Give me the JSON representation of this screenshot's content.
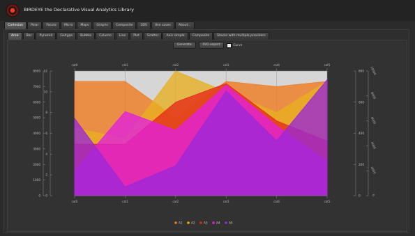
{
  "app": {
    "title": "BIRDEYE the Declarative Visual Analytics Library"
  },
  "main_tabs": [
    "Cartesian",
    "Polar",
    "Facets",
    "Micro",
    "Maps",
    "Graphs",
    "Composite",
    "3DS",
    "Use cases",
    "About..."
  ],
  "main_active": 0,
  "sub_tabs": [
    "Area",
    "Bar",
    "Pyramid",
    "Gohype",
    "Bubble",
    "Column",
    "Line",
    "Plot",
    "Scatter",
    "Axis simple",
    "Composite",
    "Stacks with multiple providers"
  ],
  "sub_active": 0,
  "toolbar": {
    "btn1": "Generate",
    "btn2": "SVG export",
    "curve_label": "Curve"
  },
  "colors": {
    "A1": "#f07a1e",
    "A2": "#e8b020",
    "A3": "#e62a1a",
    "A4": "#e020e0",
    "A5": "#9a28d8"
  },
  "chart_data": {
    "type": "area",
    "categories": [
      "cat0",
      "cat1",
      "cat2",
      "cat3",
      "cat4",
      "cat5"
    ],
    "left_axis_outer": {
      "ticks": [
        0,
        1000,
        2000,
        3000,
        4000,
        5000,
        6000,
        7000,
        8000
      ]
    },
    "left_axis_inner": {
      "ticks": [
        0,
        2,
        4,
        6,
        8,
        10,
        12
      ]
    },
    "right_axis_inner": {
      "ticks": [
        0,
        200,
        400,
        600,
        800
      ]
    },
    "right_axis_outer": {
      "ticks": [
        2000,
        4000,
        6000,
        8000,
        10000
      ]
    },
    "legend": [
      "A1",
      "A2",
      "A3",
      "A4",
      "A5"
    ],
    "series": [
      {
        "name": "A1",
        "axis": "left_inner",
        "values": [
          11,
          11,
          7.5,
          11,
          10.5,
          11
        ]
      },
      {
        "name": "A2",
        "axis": "left_inner",
        "values": [
          6.5,
          5.5,
          12,
          10,
          8,
          11
        ]
      },
      {
        "name": "A3",
        "axis": "right_inner",
        "values": [
          330,
          330,
          600,
          720,
          480,
          350
        ]
      },
      {
        "name": "A4",
        "axis": "left_outer",
        "values": [
          1600,
          5400,
          4200,
          7100,
          4500,
          2200
        ]
      },
      {
        "name": "A5",
        "axis": "right_outer",
        "values": [
          6200,
          700,
          2400,
          8400,
          4400,
          9300
        ]
      }
    ]
  }
}
